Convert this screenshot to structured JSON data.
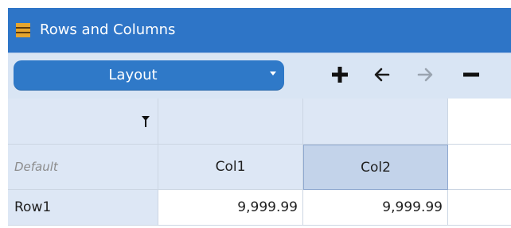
{
  "window": {
    "title": "Rows and Columns",
    "icon": "table-icon"
  },
  "toolbar": {
    "layout_label": "Layout",
    "add_icon": "plus-icon",
    "move_left_icon": "arrow-left-icon",
    "move_right_icon": "arrow-right-icon",
    "remove_icon": "minus-icon"
  },
  "grid": {
    "filter_icon": "filter-icon",
    "corner_label": "Default",
    "columns": [
      "Col1",
      "Col2"
    ],
    "rows": [
      {
        "label": "Row1",
        "values": [
          "9,999.99",
          "9,999.99"
        ]
      }
    ],
    "selected_column": "Col2"
  },
  "colors": {
    "accent": "#2e75c7",
    "header_bg": "#dde7f5",
    "selected_bg": "#c3d3ea"
  }
}
